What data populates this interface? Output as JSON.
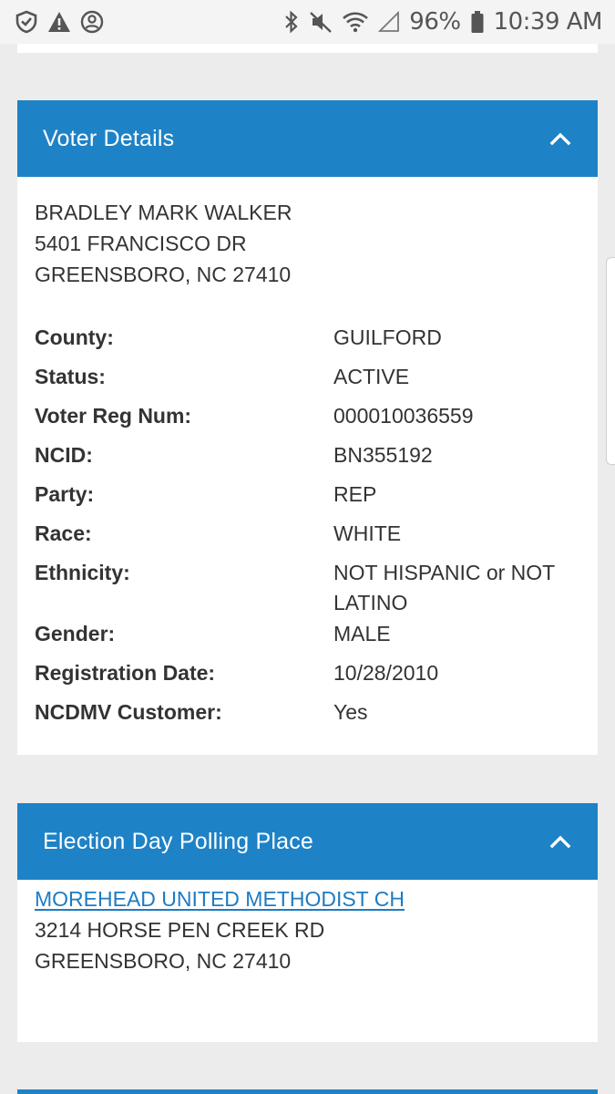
{
  "status_bar": {
    "battery": "96%",
    "time": "10:39 AM"
  },
  "voter_details": {
    "title": "Voter Details",
    "name": "BRADLEY MARK WALKER",
    "street": "5401 FRANCISCO DR",
    "city_state_zip": "GREENSBORO, NC 27410",
    "fields": [
      {
        "label": "County:",
        "value": "GUILFORD"
      },
      {
        "label": "Status:",
        "value": "ACTIVE"
      },
      {
        "label": "Voter Reg Num:",
        "value": "000010036559"
      },
      {
        "label": "NCID:",
        "value": "BN355192"
      },
      {
        "label": "Party:",
        "value": "REP"
      },
      {
        "label": "Race:",
        "value": "WHITE"
      },
      {
        "label": "Ethnicity:",
        "value_line1": "NOT HISPANIC or NOT",
        "value_line2": "LATINO"
      },
      {
        "label": "Gender:",
        "value": "MALE"
      },
      {
        "label": "Registration Date:",
        "value": "10/28/2010"
      },
      {
        "label": "NCDMV Customer:",
        "value": "Yes"
      }
    ]
  },
  "polling_place": {
    "title": "Election Day Polling Place",
    "name": "MOREHEAD UNITED METHODIST CH",
    "street": "3214 HORSE PEN CREEK RD",
    "city_state_zip": "GREENSBORO, NC 27410"
  },
  "colors": {
    "header_blue": "#1e82c6",
    "link_blue": "#1e7bc3",
    "page_bg": "#ececec"
  },
  "icons": {
    "status_left": [
      "shield-check-icon",
      "warning-icon",
      "account-circle-icon"
    ],
    "status_right": [
      "bluetooth-icon",
      "mute-icon",
      "wifi-icon",
      "signal-icon",
      "battery-icon"
    ],
    "panel_toggle": "chevron-up-icon"
  }
}
